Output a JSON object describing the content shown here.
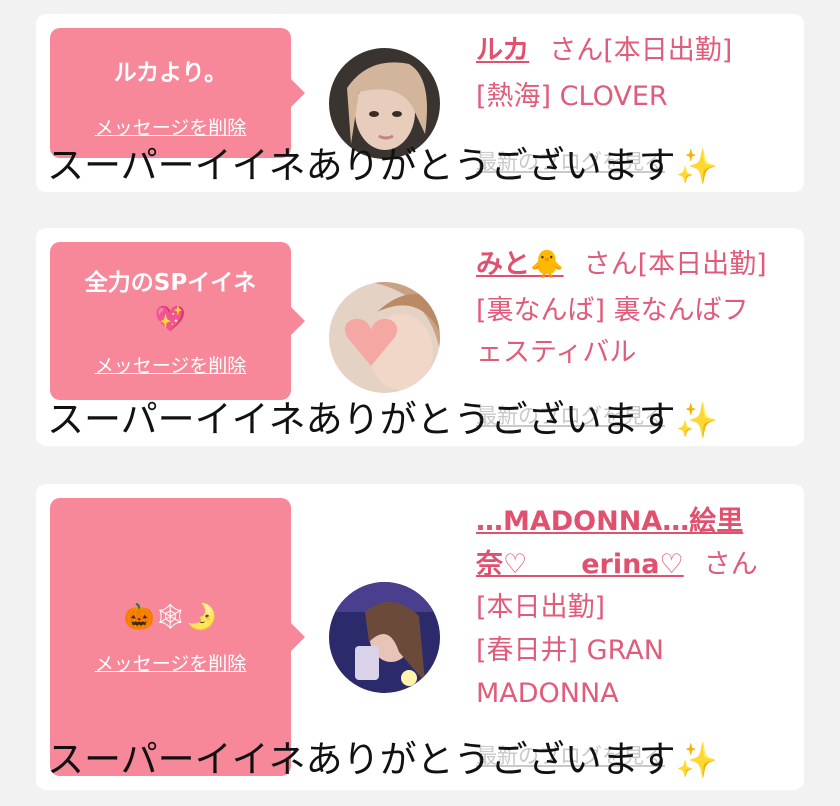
{
  "cards": [
    {
      "message": "ルカより。",
      "delete_label": "メッセージを削除",
      "name": "ルカ",
      "san": "さん",
      "status": "[本日出勤]",
      "area": "[熱海]",
      "shop": "CLOVER",
      "latest_label": "最新のブログを見る"
    },
    {
      "message": "全力のSPイイネ",
      "message_emoji": "💖",
      "delete_label": "メッセージを削除",
      "name": "みと🐥",
      "san": "さん",
      "status": "[本日出勤]",
      "area": "[裏なんば]",
      "shop_line1": "裏なんばフ",
      "shop_line2": "ェスティバル",
      "latest_label": "最新のブログを見る"
    },
    {
      "message": "🎃🕸🌛",
      "delete_label": "メッセージを削除",
      "name_line1": "…MADONNA…絵里",
      "name_line2": "奈♡　　erina♡",
      "san": "さん",
      "status": "[本日出勤]",
      "area": "[春日井]",
      "shop_line1": "GRAN",
      "shop_line2": "MADONNA",
      "latest_label": "最新のブログを見る"
    }
  ],
  "overlay_text": "スーパーイイネありがとうございます",
  "overlay_sparkle": "✨",
  "colors": {
    "bubble": "#f6889a",
    "name": "#e0506f",
    "text": "#e05c7a",
    "background": "#f2f2f2"
  }
}
